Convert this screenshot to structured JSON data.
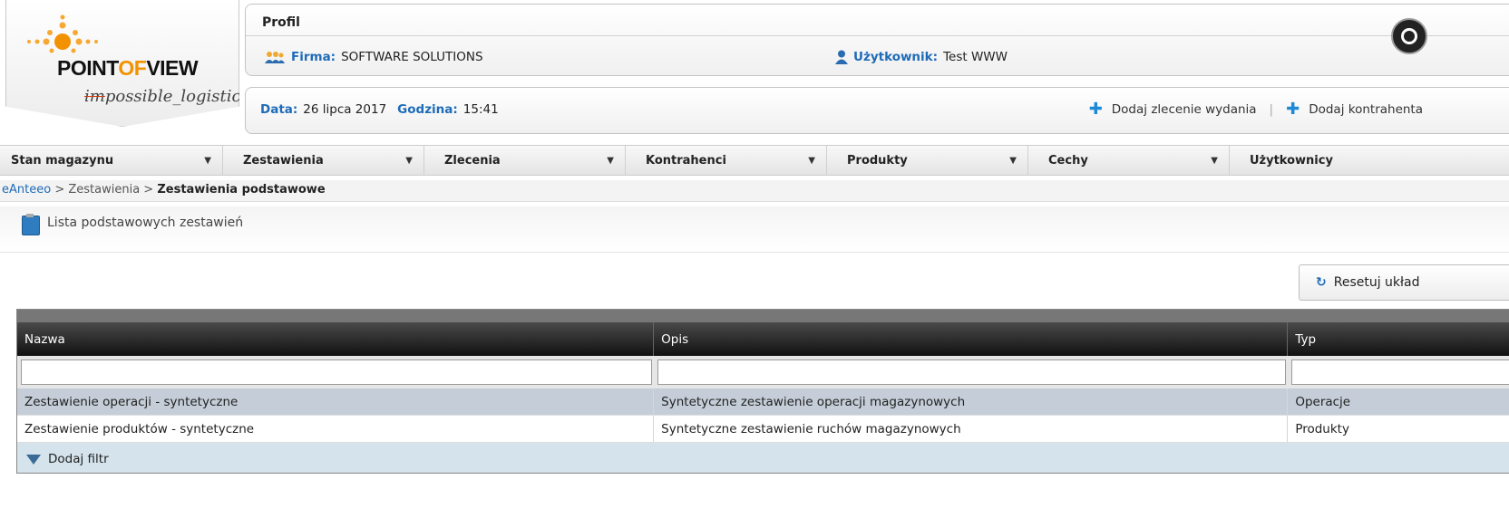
{
  "logo": {
    "brand_pre": "POINT",
    "brand_of": "OF",
    "brand_post": "VIEW",
    "tag_strike": "im",
    "tag_rest": "possible_logistics"
  },
  "profile": {
    "title": "Profil",
    "firma_label": "Firma:",
    "firma_value": "SOFTWARE SOLUTIONS",
    "user_label": "Użytkownik:",
    "user_value": "Test WWW"
  },
  "datebar": {
    "date_label": "Data:",
    "date_value": "26 lipca 2017",
    "time_label": "Godzina:",
    "time_value": "15:41",
    "action_1": "Dodaj zlecenie wydania",
    "action_2": "Dodaj kontrahenta"
  },
  "menu": [
    {
      "label": "Stan magazynu"
    },
    {
      "label": "Zestawienia"
    },
    {
      "label": "Zlecenia"
    },
    {
      "label": "Kontrahenci"
    },
    {
      "label": "Produkty"
    },
    {
      "label": "Cechy"
    },
    {
      "label": "Użytkownicy"
    }
  ],
  "breadcrumb": {
    "root": "eAnteeo",
    "sep": " > ",
    "mid": "Zestawienia",
    "current": "Zestawienia podstawowe"
  },
  "section": {
    "title": "Lista podstawowych zestawień"
  },
  "reset_button": "Resetuj układ",
  "grid": {
    "columns": [
      "Nazwa",
      "Opis",
      "Typ"
    ],
    "rows": [
      [
        "Zestawienie operacji - syntetyczne",
        "Syntetyczne zestawienie operacji magazynowych",
        "Operacje"
      ],
      [
        "Zestawienie produktów - syntetyczne",
        "Syntetyczne zestawienie ruchów magazynowych",
        "Produkty"
      ]
    ],
    "footer": "Dodaj filtr"
  },
  "colors": {
    "accent": "#1e6bb8",
    "logo_orange": "#f39200",
    "selected_row": "#c5ced8",
    "footer_bg": "#d4e3ec"
  }
}
